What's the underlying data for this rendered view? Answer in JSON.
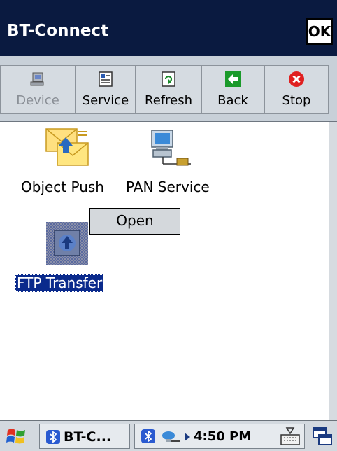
{
  "window": {
    "title": "BT-Connect",
    "ok_label": "OK"
  },
  "toolbar": {
    "buttons": [
      {
        "label": "Device",
        "icon": "device-icon",
        "enabled": false
      },
      {
        "label": "Service",
        "icon": "service-icon",
        "enabled": true
      },
      {
        "label": "Refresh",
        "icon": "refresh-icon",
        "enabled": true
      },
      {
        "label": "Back",
        "icon": "back-arrow-icon",
        "enabled": true
      },
      {
        "label": "Stop",
        "icon": "stop-icon",
        "enabled": true
      }
    ]
  },
  "services": [
    {
      "label": "Object Push",
      "icon": "object-push-icon",
      "selected": false
    },
    {
      "label": "PAN Service",
      "icon": "pan-service-icon",
      "selected": false
    },
    {
      "label": "FTP Transfer",
      "icon": "ftp-transfer-icon",
      "selected": true
    }
  ],
  "context_menu": {
    "items": [
      {
        "label": "Open"
      }
    ]
  },
  "taskbar": {
    "start_icon": "windows-flag-icon",
    "task_label": "BT-C...",
    "clock": "4:50 PM",
    "tray_icons": [
      "bluetooth-icon",
      "network-icon",
      "arrow-icon"
    ],
    "keyboard_icon": "keyboard-icon",
    "windows_icon": "window-switch-icon"
  },
  "colors": {
    "title_bar": "#0a1a40",
    "selection": "#0a2a8c",
    "toolbar": "#c8d0d8",
    "stop_red": "#e02020",
    "back_green": "#1a9a2a"
  }
}
